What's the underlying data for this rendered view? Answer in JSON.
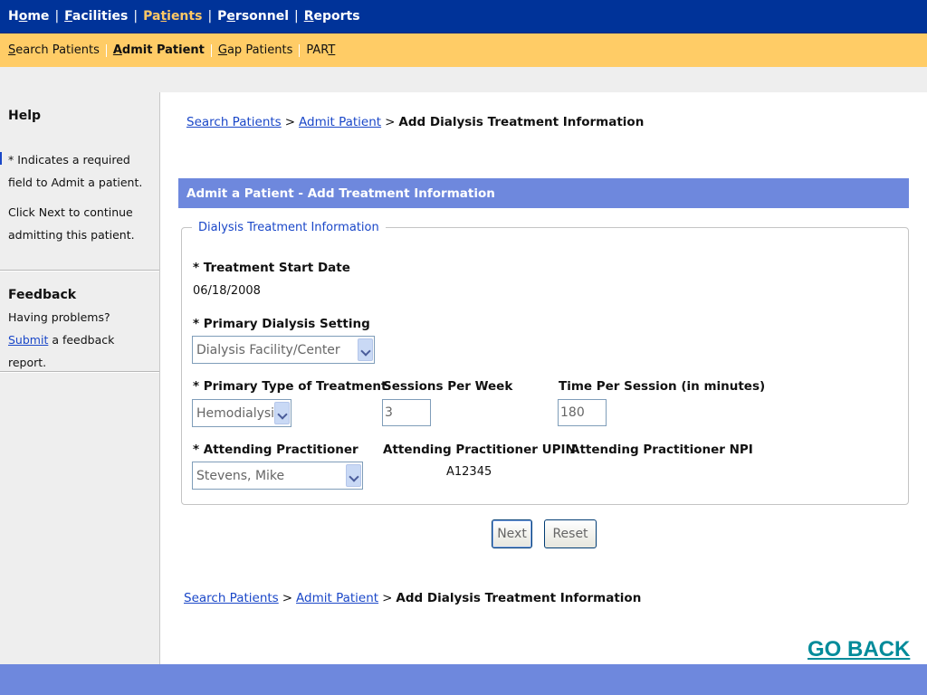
{
  "topnav": {
    "items": [
      {
        "pre": "H",
        "key": "o",
        "post": "me"
      },
      {
        "pre": "",
        "key": "F",
        "post": "acilities"
      },
      {
        "pre": "Pa",
        "key": "t",
        "post": "ients"
      },
      {
        "pre": "P",
        "key": "e",
        "post": "rsonnel"
      },
      {
        "pre": "",
        "key": "R",
        "post": "eports"
      }
    ],
    "separator": "|",
    "active_index": 2
  },
  "subnav": {
    "items": [
      {
        "pre": "",
        "key": "S",
        "post": "earch Patients"
      },
      {
        "pre": "",
        "key": "A",
        "post": "dmit Patient"
      },
      {
        "pre": "",
        "key": "G",
        "post": "ap Patients"
      },
      {
        "pre": "PAR",
        "key": "T",
        "post": ""
      }
    ],
    "active_index": 1
  },
  "sidebar": {
    "help_title": "Help",
    "help_text_1": "* Indicates a required field to Admit a patient.",
    "help_text_2": "Click Next to continue admitting this patient.",
    "feedback_title": "Feedback",
    "feedback_prefix": "Having problems? ",
    "feedback_link": "Submit",
    "feedback_suffix": " a feedback report."
  },
  "breadcrumb": {
    "link1": "Search Patients",
    "link2": "Admit Patient",
    "separator": ">",
    "current": "Add Dialysis Treatment Information"
  },
  "panel": {
    "title": "Admit a Patient - Add Treatment Information",
    "legend": "Dialysis Treatment Information"
  },
  "form": {
    "start_date_label": "* Treatment Start Date",
    "start_date_value": "06/18/2008",
    "setting_label": "* Primary Dialysis Setting",
    "setting_value": "Dialysis Facility/Center",
    "treatment_type_label": "* Primary Type of Treatment",
    "treatment_type_value": "Hemodialysis",
    "sessions_label": "Sessions Per Week",
    "sessions_value": "3",
    "time_label": "Time Per Session (in minutes)",
    "time_value": "180",
    "practitioner_label": "* Attending Practitioner",
    "practitioner_value": "Stevens, Mike",
    "upin_label": "Attending Practitioner UPIN",
    "upin_value": "A12345",
    "npi_label": "Attending Practitioner NPI"
  },
  "buttons": {
    "next": "Next",
    "reset": "Reset"
  },
  "footer": {
    "go_back": "GO BACK"
  },
  "colors": {
    "nav_blue": "#003399",
    "subnav_yellow": "#ffcc66",
    "panel_blue": "#6e88dd",
    "link_blue": "#1a47c8",
    "go_back_teal": "#008b9a"
  }
}
